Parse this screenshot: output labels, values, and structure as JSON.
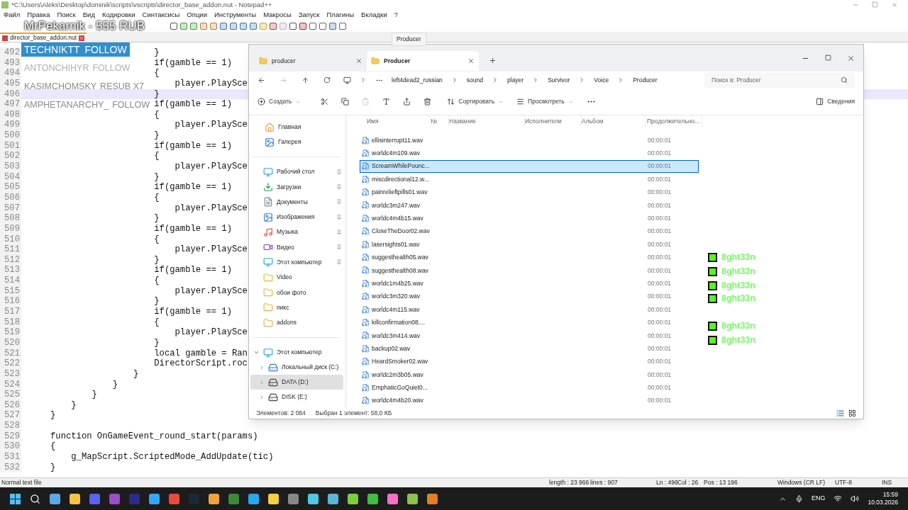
{
  "notepad": {
    "title": "*C:\\Users\\Aleks\\Desktop\\dominik\\scripts\\vscripts\\director_base_addon.nut - Notepad++",
    "menu": [
      "Файл",
      "Правка",
      "Поиск",
      "Вид",
      "Кодировки",
      "Синтаксисы",
      "Опции",
      "Инструменты",
      "Макросы",
      "Запуск",
      "Плагины",
      "Вкладки",
      "?"
    ],
    "tab": {
      "label": "director_base_addon.nut",
      "modified": true
    },
    "lines": [
      {
        "number": "492",
        "code": "                    }",
        "selected": false
      },
      {
        "number": "493",
        "code": "                    if(gamble == 1)",
        "selected": false
      },
      {
        "number": "494",
        "code": "                    {",
        "selected": false
      },
      {
        "number": "495",
        "code": "                        player.PlaySce",
        "selected": false
      },
      {
        "number": "496",
        "code": "                    }",
        "selected": true
      },
      {
        "number": "497",
        "code": "                    if(gamble == 1)",
        "selected": false
      },
      {
        "number": "498",
        "code": "                    {",
        "selected": false
      },
      {
        "number": "499",
        "code": "                        player.PlaySce",
        "selected": false
      },
      {
        "number": "500",
        "code": "                    }",
        "selected": false
      },
      {
        "number": "501",
        "code": "                    if(gamble == 1)",
        "selected": false
      },
      {
        "number": "502",
        "code": "                    {",
        "selected": false
      },
      {
        "number": "503",
        "code": "                        player.PlaySce",
        "selected": false
      },
      {
        "number": "504",
        "code": "                    }",
        "selected": false
      },
      {
        "number": "505",
        "code": "                    if(gamble == 1)",
        "selected": false
      },
      {
        "number": "506",
        "code": "                    {",
        "selected": false
      },
      {
        "number": "507",
        "code": "                        player.PlaySce",
        "selected": false
      },
      {
        "number": "508",
        "code": "                    }",
        "selected": false
      },
      {
        "number": "509",
        "code": "                    if(gamble == 1)",
        "selected": false
      },
      {
        "number": "510",
        "code": "                    {",
        "selected": false
      },
      {
        "number": "511",
        "code": "                        player.PlaySce",
        "selected": false
      },
      {
        "number": "512",
        "code": "                    }",
        "selected": false
      },
      {
        "number": "513",
        "code": "                    if(gamble == 1)",
        "selected": false
      },
      {
        "number": "514",
        "code": "                    {",
        "selected": false
      },
      {
        "number": "515",
        "code": "                        player.PlaySce",
        "selected": false
      },
      {
        "number": "516",
        "code": "                    }",
        "selected": false
      },
      {
        "number": "517",
        "code": "                    if(gamble == 1)",
        "selected": false
      },
      {
        "number": "518",
        "code": "                    {",
        "selected": false
      },
      {
        "number": "519",
        "code": "                        player.PlaySce",
        "selected": false
      },
      {
        "number": "520",
        "code": "                    }",
        "selected": false
      },
      {
        "number": "521",
        "code": "                    local gamble = Ran",
        "selected": false
      },
      {
        "number": "522",
        "code": "                    DirectorScript.roc",
        "selected": false
      },
      {
        "number": "523",
        "code": "                }",
        "selected": false
      },
      {
        "number": "524",
        "code": "            }",
        "selected": false
      },
      {
        "number": "525",
        "code": "        }",
        "selected": false
      },
      {
        "number": "526",
        "code": "    }",
        "selected": false
      },
      {
        "number": "527",
        "code": "}",
        "selected": false
      },
      {
        "number": "528",
        "selected": false
      },
      {
        "number": "529",
        "code": "function OnGameEvent_round_start(params)",
        "selected": false
      },
      {
        "number": "530",
        "code": "{",
        "selected": false
      },
      {
        "number": "531",
        "code": "    g_MapScript.ScriptedMode_AddUpdate(tic)",
        "selected": false
      },
      {
        "number": "532",
        "code": "}",
        "selected": false
      }
    ],
    "status": {
      "file_type": "Normal text file",
      "length": "length : 23 966",
      "lines": "lines : 907",
      "ln": "Ln : 496",
      "col": "Col : 26",
      "pos": "Pos : 13 196",
      "eol": "Windows (CR LF)",
      "encoding": "UTF-8",
      "mode": "INS"
    }
  },
  "tooltip": "Producer",
  "explorer": {
    "tabs": [
      {
        "label": "producer",
        "selected": false
      },
      {
        "label": "Producer",
        "selected": true
      }
    ],
    "breadcrumb": [
      "left4dead2_russian",
      "sound",
      "player",
      "Survivor",
      "Voice",
      "Producer"
    ],
    "search": {
      "placeholder": "Поиск в: Producer"
    },
    "toolbar": {
      "create": "Создать",
      "sort": "Сортировать",
      "view": "Просмотреть",
      "details": "Сведения"
    },
    "columns": [
      "Имя",
      "№",
      "Название",
      "Исполнители",
      "Альбом",
      "Продолжительно..."
    ],
    "files": [
      {
        "name": "ellisinterrupt11.wav",
        "duration": "00:00:01",
        "selected": false
      },
      {
        "name": "worldc4m109.wav",
        "duration": "00:00:01",
        "selected": false
      },
      {
        "name": "ScreamWhilePounc...",
        "duration": "00:00:01",
        "selected": true
      },
      {
        "name": "miscdirectional12.w...",
        "duration": "00:00:01",
        "selected": false
      },
      {
        "name": "painrelieftpills01.wav",
        "duration": "00:00:01",
        "selected": false
      },
      {
        "name": "worldc3m247.wav",
        "duration": "00:00:01",
        "selected": false
      },
      {
        "name": "worldc4m4b15.wav",
        "duration": "00:00:01",
        "selected": false
      },
      {
        "name": "CloseTheDoor02.wav",
        "duration": "00:00:01",
        "selected": false
      },
      {
        "name": "lasersights01.wav",
        "duration": "00:00:01",
        "selected": false
      },
      {
        "name": "suggesthealth05.wav",
        "duration": "00:00:01",
        "selected": false
      },
      {
        "name": "suggesthealth08.wav",
        "duration": "00:00:01",
        "selected": false
      },
      {
        "name": "worldc1m4b25.wav",
        "duration": "00:00:01",
        "selected": false
      },
      {
        "name": "worldc3m320.wav",
        "duration": "00:00:01",
        "selected": false
      },
      {
        "name": "worldc4m115.wav",
        "duration": "00:00:01",
        "selected": false
      },
      {
        "name": "killconfirmation08....",
        "duration": "00:00:01",
        "selected": false
      },
      {
        "name": "worldc3m414.wav",
        "duration": "00:00:01",
        "selected": false
      },
      {
        "name": "backup02.wav",
        "duration": "00:00:01",
        "selected": false
      },
      {
        "name": "HeardSmoker02.wav",
        "duration": "00:00:01",
        "selected": false
      },
      {
        "name": "worldc2m3b05.wav",
        "duration": "00:00:01",
        "selected": false
      },
      {
        "name": "EmphaticGoQuiet0...",
        "duration": "00:00:01",
        "selected": false
      },
      {
        "name": "worldc4m4b20.wav",
        "duration": "00:00:01",
        "selected": false
      }
    ],
    "nav_top": [
      {
        "label": "Главная",
        "kind": "home"
      },
      {
        "label": "Галерея",
        "kind": "gallery"
      }
    ],
    "nav_pinned": [
      {
        "label": "Рабочий стол",
        "kind": "desktop",
        "pinned": true
      },
      {
        "label": "Загрузки",
        "kind": "downloads",
        "pinned": true
      },
      {
        "label": "Документы",
        "kind": "documents",
        "pinned": true
      },
      {
        "label": "Изображения",
        "kind": "images",
        "pinned": true
      },
      {
        "label": "Музыка",
        "kind": "music",
        "pinned": true
      },
      {
        "label": "Видео",
        "kind": "video",
        "pinned": true
      },
      {
        "label": "Этот компьютер",
        "kind": "pc",
        "pinned": true
      },
      {
        "label": "Video",
        "kind": "folder",
        "pinned": false
      },
      {
        "label": "обои фото",
        "kind": "folder",
        "pinned": false
      },
      {
        "label": "пикс",
        "kind": "folder",
        "pinned": false
      },
      {
        "label": "addons",
        "kind": "folder",
        "pinned": false
      }
    ],
    "tree": {
      "label": "Этот компьютер",
      "expanded": true,
      "children": [
        {
          "label": "Локальный диск (C:)",
          "kind": "system",
          "selected": false
        },
        {
          "label": "DATA (D:)",
          "kind": "drive",
          "selected": true
        },
        {
          "label": "DISK (E:)",
          "kind": "drive",
          "selected": false
        }
      ]
    },
    "status": {
      "count": "Элементов: 2 084",
      "selection": "Выбран 1 элемент: 58,0 КБ"
    }
  },
  "stream": {
    "donation": "MrPekarnik - 555 RUB",
    "alerts": [
      {
        "name": "TECHNIKTT",
        "action": "FOLLOW",
        "kind": "active"
      },
      {
        "name": "ANTONCHIHYR",
        "action": "FOLLOW",
        "kind": "faded"
      },
      {
        "name": "KASIMCHOMSKY",
        "action": "RESUB X7",
        "kind": "dim"
      },
      {
        "name": "AMPHETANARCHY_",
        "action": "FOLLOW",
        "kind": "dim"
      }
    ],
    "chat": [
      {
        "user": "8ght33n"
      },
      {
        "user": "8ght33n"
      },
      {
        "user": "8ght33n"
      },
      {
        "user": "8ght33n",
        "wrapped": true
      },
      {
        "user": "8ght33n"
      },
      {
        "user": "8ght33n"
      }
    ]
  },
  "taskbar": {
    "language": "ENG",
    "time": "15:59",
    "date": "10.03.2026"
  }
}
